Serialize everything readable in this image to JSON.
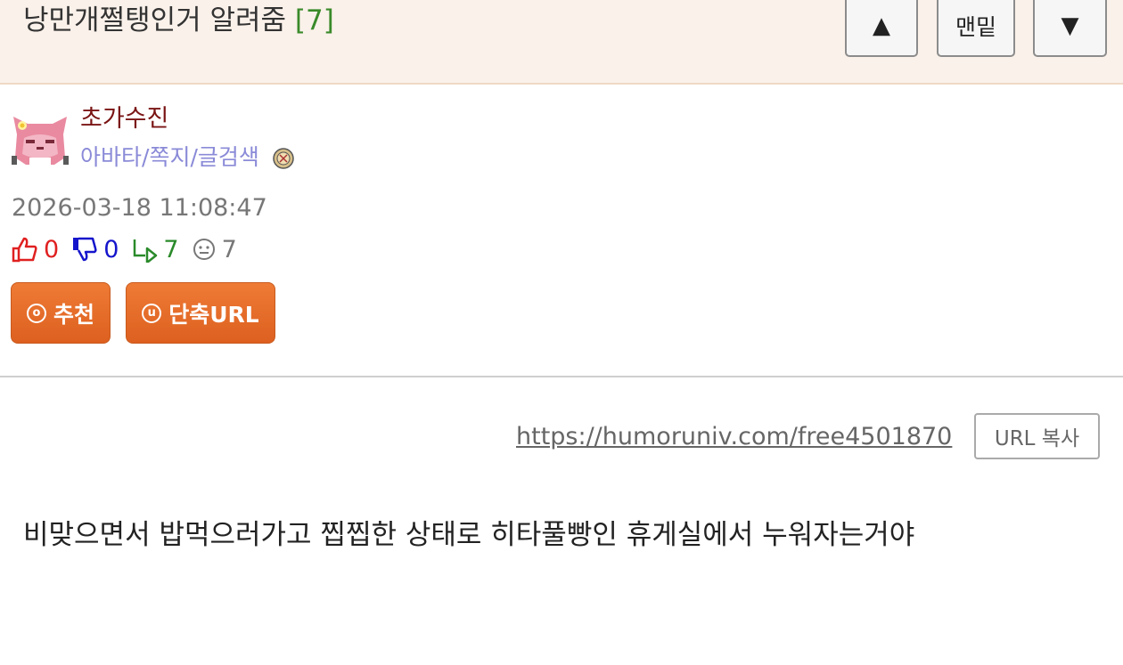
{
  "post": {
    "title": "낭만개쩔탱인거 알려줌",
    "comment_count": "[7]",
    "body": "비맞으면서 밥먹으러가고 찝찝한 상태로 히타풀빵인 휴게실에서 누워자는거야"
  },
  "nav": {
    "up": "▲",
    "bottom": "맨밑",
    "down": "▼"
  },
  "author": {
    "nickname": "초가수진",
    "link_avatar": "아바타",
    "link_message": "쪽지",
    "link_search": "글검색",
    "sep": "/",
    "avatar_icon": "pink-cat-avatar",
    "medal_icon": "medal-icon"
  },
  "meta": {
    "date": "2026-03-18 11:08:47",
    "upvotes": "0",
    "downvotes": "0",
    "replies": "7",
    "views": "7"
  },
  "actions": {
    "recommend_label": "추천",
    "short_url_label": "단축URL"
  },
  "url": {
    "link": "https://humoruniv.com/free4501870",
    "copy_label": "URL 복사"
  },
  "colors": {
    "header_bg": "#faf1ea",
    "nickname": "#7a1414",
    "links": "#8a8ad8",
    "button_orange": "#e56a28",
    "count_green": "#3a8a2a",
    "upvote_red": "#e02020",
    "downvote_blue": "#1515cc"
  }
}
